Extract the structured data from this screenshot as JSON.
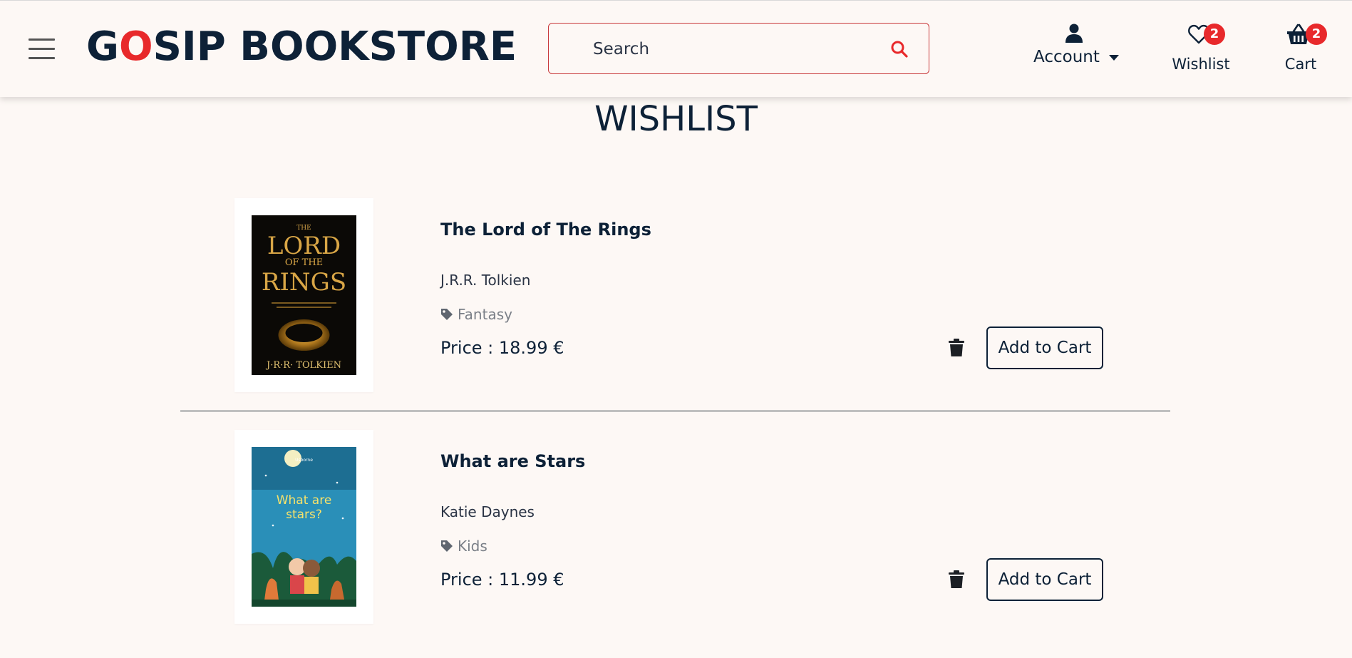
{
  "header": {
    "brand_g": "G",
    "brand_o": "O",
    "brand_rest": "SIP BOOKSTORE",
    "search_placeholder": "Search",
    "account_label": "Account",
    "wishlist_label": "Wishlist",
    "wishlist_count": "2",
    "cart_label": "Cart",
    "cart_count": "2"
  },
  "page_title": "WISHLIST",
  "items": [
    {
      "title": "The Lord of The Rings",
      "author": "J.R.R. Tolkien",
      "genre": "Fantasy",
      "price": "Price : 18.99 €",
      "add_label": "Add to Cart",
      "cover": {
        "line1": "THE",
        "line2": "LORD",
        "line3": "OF THE",
        "line4": "RINGS",
        "author": "J·R·R· TOLKIEN"
      }
    },
    {
      "title": "What are Stars",
      "author": "Katie Daynes",
      "genre": "Kids",
      "price": "Price : 11.99 €",
      "add_label": "Add to Cart",
      "cover": {
        "publisher": "Usborne",
        "line1": "What are",
        "line2": "stars?"
      }
    }
  ],
  "colors": {
    "navy": "#0d2137",
    "accent_red": "#e8292b",
    "background": "#fdf8f5"
  },
  "icons": [
    "hamburger-icon",
    "search-icon",
    "user-icon",
    "heart-icon",
    "basket-icon",
    "tag-icon",
    "trash-icon"
  ]
}
